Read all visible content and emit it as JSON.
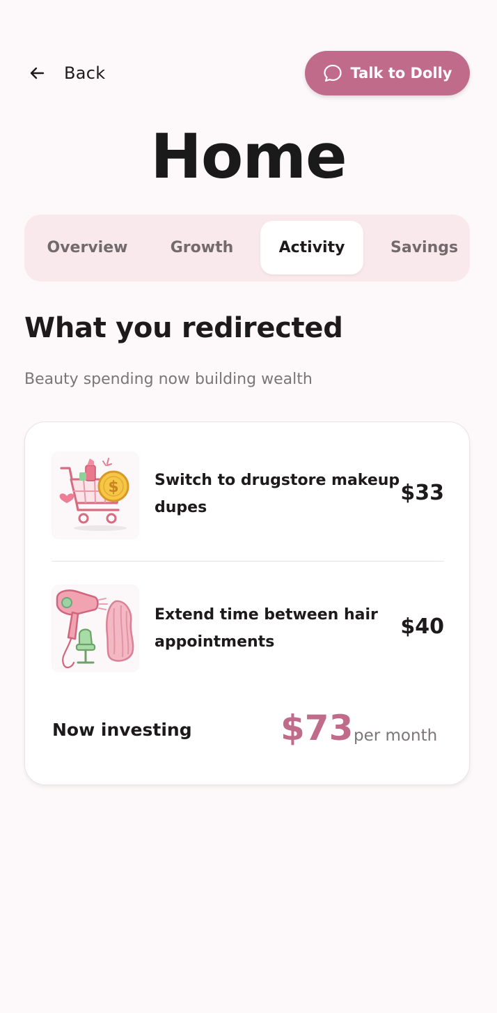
{
  "header": {
    "back_label": "Back",
    "talk_label": "Talk to Dolly",
    "title": "Home"
  },
  "tabs": [
    {
      "label": "Overview",
      "active": false
    },
    {
      "label": "Growth",
      "active": false
    },
    {
      "label": "Activity",
      "active": true
    },
    {
      "label": "Savings",
      "active": false
    }
  ],
  "section": {
    "title": "What you redirected",
    "subtitle": "Beauty spending now building wealth"
  },
  "card": {
    "items": [
      {
        "label": "Switch to drugstore makeup dupes",
        "amount": "$33",
        "icon": "shopping-cart-makeup-icon"
      },
      {
        "label": "Extend time between hair appointments",
        "amount": "$40",
        "icon": "hair-dryer-salon-icon"
      }
    ],
    "investing_label": "Now investing",
    "investing_amount": "$73",
    "investing_unit": "per month"
  },
  "colors": {
    "accent": "#c06b8a",
    "background": "#fdf8f9",
    "tab_bar": "#f9e9ed",
    "text_primary": "#1c1a1b",
    "text_secondary": "#7c7577"
  }
}
